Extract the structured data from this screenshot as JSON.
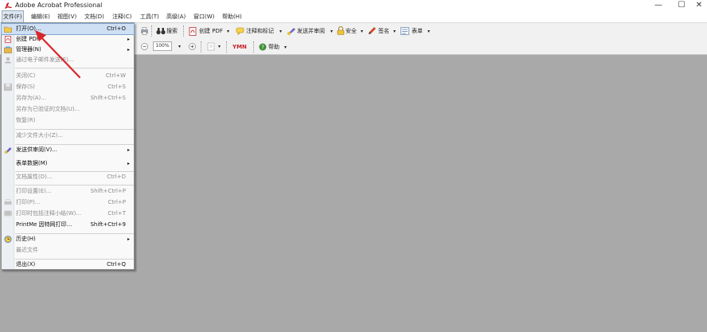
{
  "window": {
    "title": "Adobe Acrobat Professional",
    "minimize_glyph": "—",
    "maximize_glyph": "☐",
    "close_glyph": "✕"
  },
  "menubar": {
    "items": [
      {
        "label": "文件(F)"
      },
      {
        "label": "编辑(E)"
      },
      {
        "label": "视图(V)"
      },
      {
        "label": "文档(D)"
      },
      {
        "label": "注释(C)"
      },
      {
        "label": "工具(T)"
      },
      {
        "label": "高级(A)"
      },
      {
        "label": "窗口(W)"
      },
      {
        "label": "帮助(H)"
      }
    ]
  },
  "toolbar": {
    "search_label": "搜索",
    "create_pdf_label": "创建 PDF",
    "comment_label": "注释和标记",
    "send_review_label": "发送并审阅",
    "secure_label": "安全",
    "sign_label": "签名",
    "forms_label": "表单",
    "zoom_value": "100%",
    "help_label": "帮助",
    "ymn_label": "YMN",
    "dropdown_glyph": "▾"
  },
  "file_menu": {
    "items": [
      {
        "label": "打开(O)...",
        "shortcut": "Ctrl+O"
      },
      {
        "label": "创建 PDF",
        "shortcut": ""
      },
      {
        "label": "管理器(N)",
        "shortcut": ""
      },
      {
        "label": "通过电子邮件发送(E)...",
        "shortcut": ""
      },
      {
        "label": "关闭(C)",
        "shortcut": "Ctrl+W"
      },
      {
        "label": "保存(S)",
        "shortcut": "Ctrl+S"
      },
      {
        "label": "另存为(A)...",
        "shortcut": "Shift+Ctrl+S"
      },
      {
        "label": "另存为已验证的文档(U)...",
        "shortcut": ""
      },
      {
        "label": "恢复(R)",
        "shortcut": ""
      },
      {
        "label": "减少文件大小(Z)...",
        "shortcut": ""
      },
      {
        "label": "发送供审阅(V)...",
        "shortcut": ""
      },
      {
        "label": "表单数据(M)",
        "shortcut": ""
      },
      {
        "label": "文档属性(D)...",
        "shortcut": "Ctrl+D"
      },
      {
        "label": "打印设置(E)...",
        "shortcut": "Shift+Ctrl+P"
      },
      {
        "label": "打印(P)...",
        "shortcut": "Ctrl+P"
      },
      {
        "label": "打印时包括注释小结(W)...",
        "shortcut": "Ctrl+T"
      },
      {
        "label": "PrintMe 因特网打印...",
        "shortcut": "Shift+Ctrl+9"
      },
      {
        "label": "历史(H)",
        "shortcut": ""
      },
      {
        "label": "最近文件",
        "shortcut": ""
      },
      {
        "label": "退出(X)",
        "shortcut": "Ctrl+Q"
      }
    ],
    "submenu_glyph": "▸"
  },
  "colors": {
    "workspace": "#a9a9a9",
    "highlight": "#cfe0f4",
    "arrow": "#d9262a"
  }
}
